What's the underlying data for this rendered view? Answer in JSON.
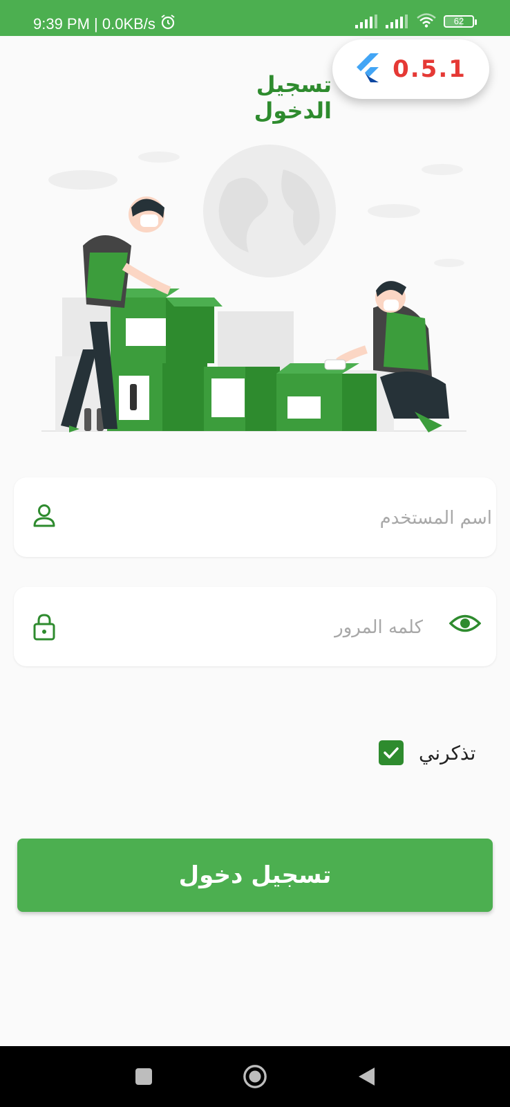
{
  "status_bar": {
    "time_speed": "9:39 PM | 0.0KB/s",
    "battery": "62"
  },
  "flutter_badge": {
    "version": "0.5.1"
  },
  "page": {
    "title": "تسجيل الدخول"
  },
  "form": {
    "username_placeholder": "اسم المستخدم",
    "username_value": "",
    "password_placeholder": "كلمه المرور",
    "password_value": "",
    "remember_label": "تذكرني",
    "remember_checked": true,
    "login_label": "تسجيل دخول"
  },
  "icons": {
    "user": "person-outline-icon",
    "lock": "lock-icon",
    "eye": "eye-icon",
    "check": "check-icon"
  },
  "colors": {
    "primary": "#4caf50",
    "primary_dark": "#2e8b2e",
    "background": "#fafafa",
    "badge_text": "#e53935"
  }
}
